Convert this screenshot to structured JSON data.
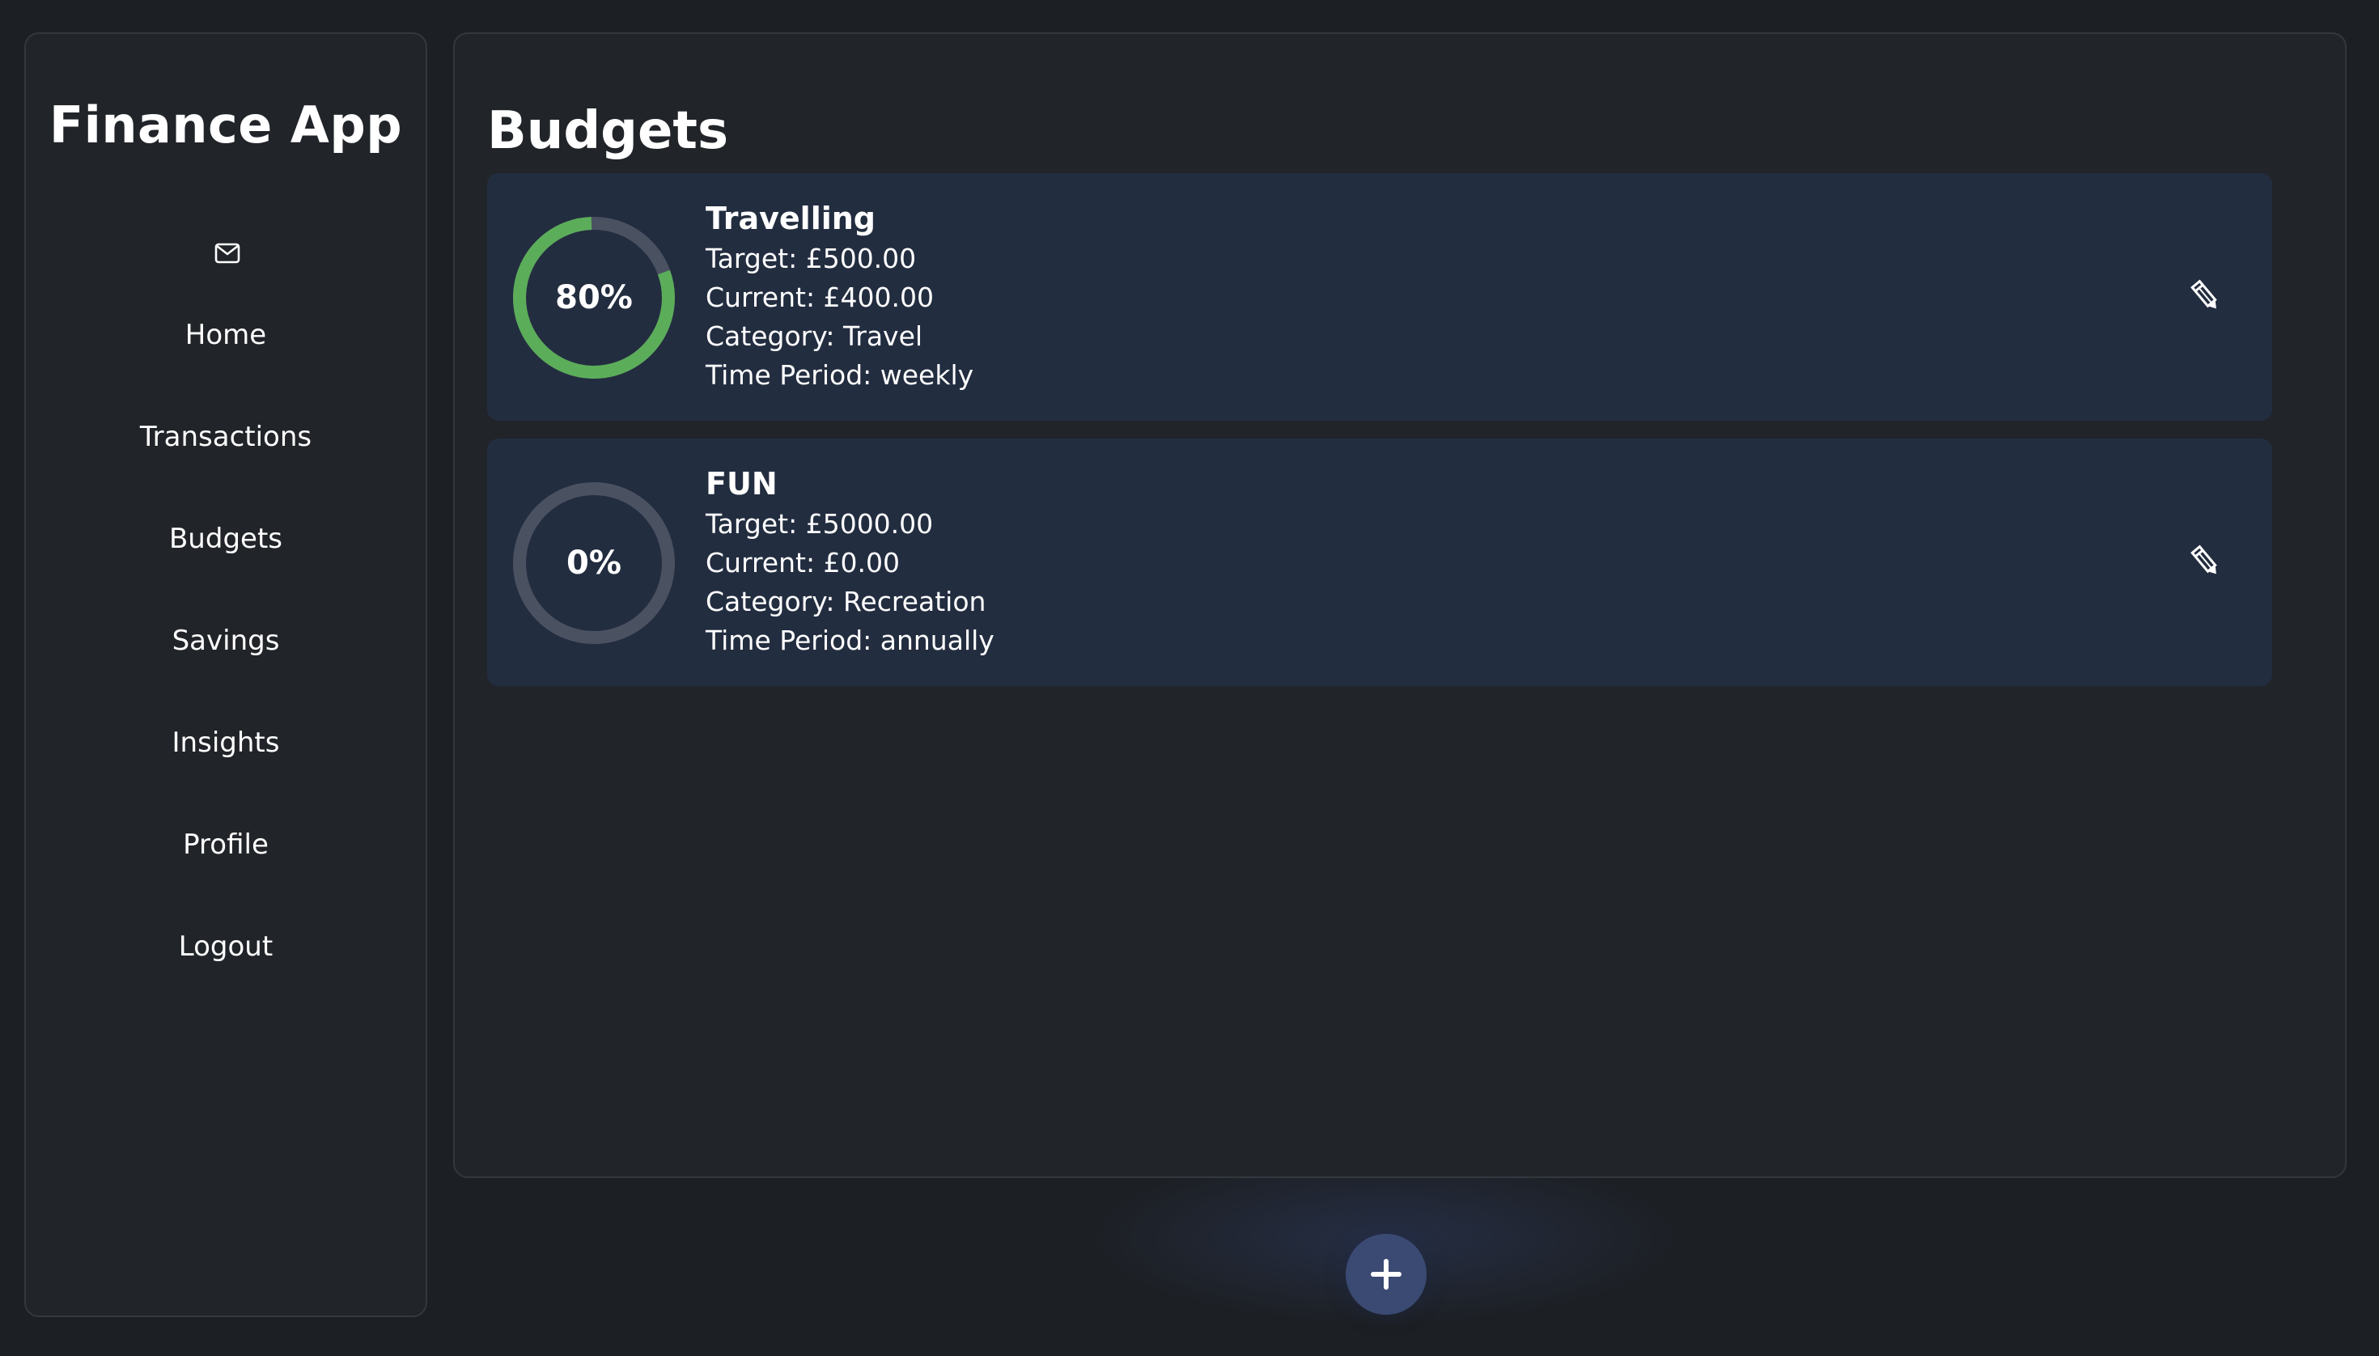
{
  "app": {
    "title": "Finance App"
  },
  "sidebar": {
    "mail_icon": "mail-icon",
    "items": [
      {
        "label": "Home"
      },
      {
        "label": "Transactions"
      },
      {
        "label": "Budgets"
      },
      {
        "label": "Savings"
      },
      {
        "label": "Insights"
      },
      {
        "label": "Profile"
      },
      {
        "label": "Logout"
      }
    ]
  },
  "main": {
    "title": "Budgets",
    "budgets": [
      {
        "name": "Travelling",
        "progress": 0.8,
        "percent_label": "80%",
        "target": "Target: £500.00",
        "current": "Current: £400.00",
        "category": "Category: Travel",
        "period": "Time Period: weekly",
        "edit_icon": "pencil-icon"
      },
      {
        "name": "FUN",
        "progress": 0,
        "percent_label": "0%",
        "target": "Target: £5000.00",
        "current": "Current: £0.00",
        "category": "Category: Recreation",
        "period": "Time Period: annually",
        "edit_icon": "pencil-icon"
      }
    ]
  },
  "fab": {
    "icon": "plus-icon"
  },
  "colors": {
    "background": "#1c1f23",
    "panel": "#212429",
    "card": "#232d40",
    "ring_track": "#4a5262",
    "ring_progress": "#5cad5a",
    "fab": "#3b4a72"
  }
}
